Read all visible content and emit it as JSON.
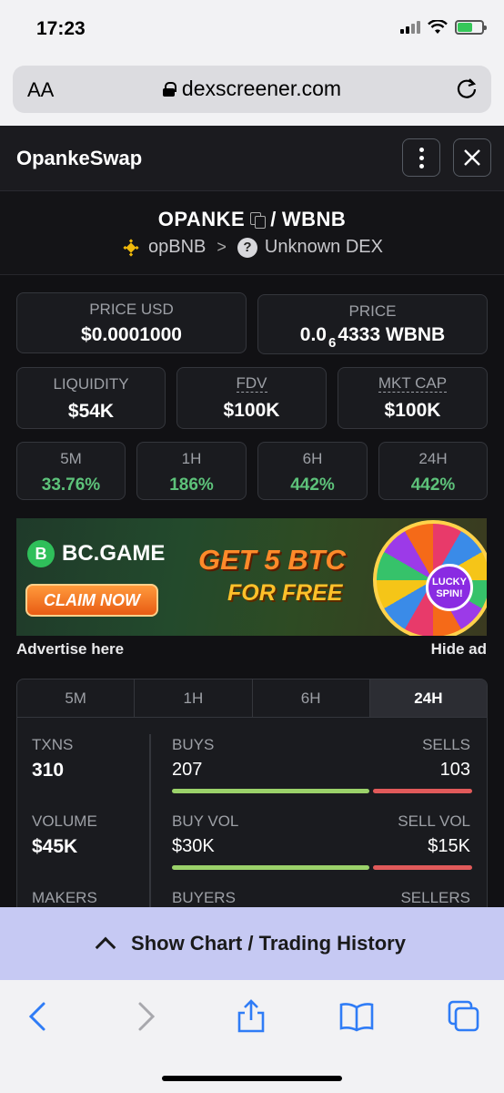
{
  "status_bar": {
    "time": "17:23"
  },
  "browser": {
    "aa_label": "AA",
    "url": "dexscreener.com"
  },
  "header": {
    "title": "OpankeSwap"
  },
  "pair": {
    "base": "OPANKE",
    "separator": "/",
    "quote": "WBNB",
    "chain": "opBNB",
    "dex": "Unknown DEX"
  },
  "prices": {
    "price_usd_label": "PRICE USD",
    "price_usd": "$0.0001000",
    "price_label": "PRICE",
    "price_prefix": "0.0",
    "price_zeros": "6",
    "price_rest": "4333 WBNB"
  },
  "metrics": [
    {
      "label": "LIQUIDITY",
      "value": "$54K"
    },
    {
      "label": "FDV",
      "value": "$100K"
    },
    {
      "label": "MKT CAP",
      "value": "$100K"
    }
  ],
  "changes": [
    {
      "label": "5M",
      "value": "33.76%"
    },
    {
      "label": "1H",
      "value": "186%"
    },
    {
      "label": "6H",
      "value": "442%"
    },
    {
      "label": "24H",
      "value": "442%"
    }
  ],
  "ad": {
    "brand": "BC.GAME",
    "claim": "CLAIM NOW",
    "headline": "GET 5 BTC",
    "subline": "FOR FREE",
    "wheel_label_1": "LUCKY",
    "wheel_label_2": "SPIN!",
    "advertise": "Advertise here",
    "hide": "Hide ad"
  },
  "stats": {
    "tabs": [
      "5M",
      "1H",
      "6H",
      "24H"
    ],
    "active_tab": "24H",
    "txns_label": "TXNS",
    "txns": "310",
    "buys_label": "BUYS",
    "buys": "207",
    "sells_label": "SELLS",
    "sells": "103",
    "volume_label": "VOLUME",
    "volume": "$45K",
    "buy_vol_label": "BUY VOL",
    "buy_vol": "$30K",
    "sell_vol_label": "SELL VOL",
    "sell_vol": "$15K",
    "makers_label": "MAKERS",
    "buyers_label": "BUYERS",
    "sellers_label": "SELLERS",
    "buy_share": 0.667,
    "buy_vol_share": 0.667,
    "buy_color": "#9bd26a",
    "sell_color": "#e15a5a"
  },
  "cta": {
    "label": "Show Chart / Trading History"
  },
  "colors": {
    "positive": "#5dc27a",
    "cta_bg": "#c6c9f3",
    "safari_blue": "#2f7cf6"
  }
}
